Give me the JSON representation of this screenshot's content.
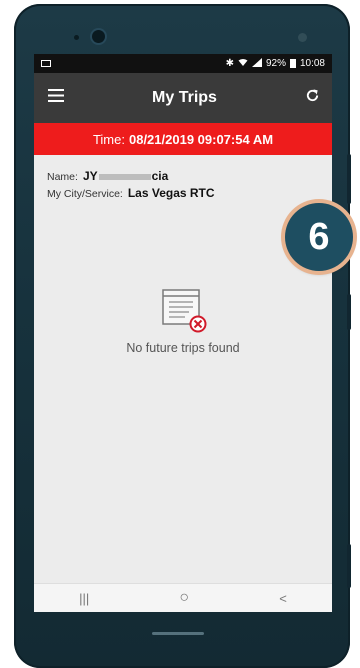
{
  "statusbar": {
    "battery": "92%",
    "clock": "10:08"
  },
  "appbar": {
    "title": "My Trips",
    "menu_icon": "hamburger-menu-icon",
    "refresh_icon": "refresh-icon"
  },
  "banner": {
    "label": "Time:",
    "value": "08/21/2019 09:07:54 AM"
  },
  "account": {
    "name_label": "Name:",
    "name_prefix": "JY",
    "name_suffix": "cia",
    "city_label": "My City/Service:",
    "city_value": "Las Vegas RTC"
  },
  "empty_state": {
    "icon": "no-trips-icon",
    "message": "No future trips found"
  },
  "overlay": {
    "step_number": "6"
  },
  "navbar": {
    "recents": "|||",
    "home": "○",
    "back": "<"
  },
  "colors": {
    "banner_red": "#ee1c1c",
    "appbar_dark": "#3a3a3a",
    "badge_blue": "#1e4e61",
    "badge_ring": "#e7b38f",
    "phone_body": "#17323d"
  }
}
